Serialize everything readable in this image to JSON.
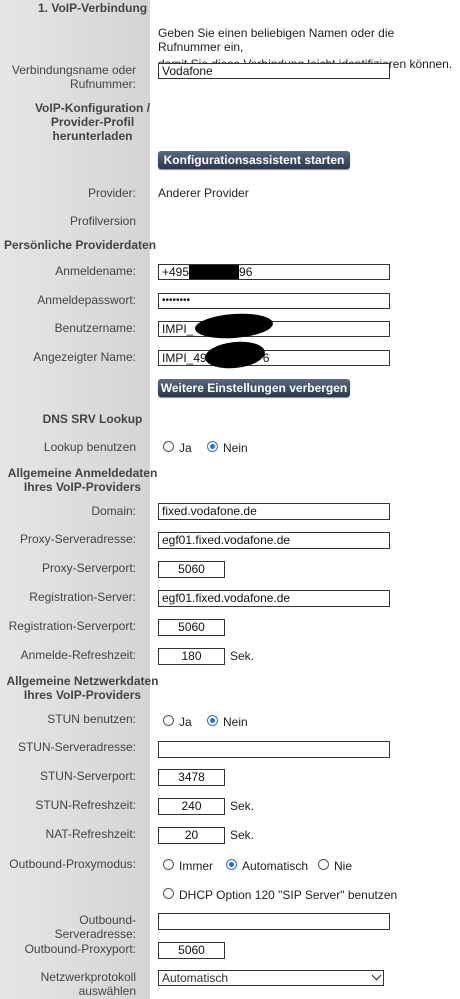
{
  "section1": {
    "title": "1. VoIP-Verbindung"
  },
  "info_text": [
    "Geben Sie einen beliebigen Namen oder die Rufnummer ein,",
    "damit Sie diese Verbindung leicht identifizieren können."
  ],
  "connection_name": {
    "label": [
      "Verbindungsname oder",
      "Rufnummer:"
    ],
    "value": "Vodafone"
  },
  "voip_config": {
    "label": [
      "VoIP-Konfiguration /",
      "Provider-Profil",
      "herunterladen"
    ],
    "button": "Konfigurationsassistent starten"
  },
  "provider": {
    "label": "Provider:",
    "value": "Anderer Provider"
  },
  "profile_version": {
    "label": "Profilversion"
  },
  "personal": {
    "title": "Persönliche Providerdaten"
  },
  "login_name": {
    "label": "Anmeldename:",
    "value_prefix": "+495",
    "value_suffix": "96"
  },
  "login_password": {
    "label": "Anmeldepasswort:",
    "value": "••••••••"
  },
  "username": {
    "label": "Benutzername:",
    "value": "IMPI_"
  },
  "display_name": {
    "label": "Angezeigter Name:",
    "value_prefix": "IMPI_49",
    "value_suffix": "6"
  },
  "more_settings_button": "Weitere Einstellungen verbergen",
  "dns": {
    "title": "DNS SRV Lookup",
    "label": "Lookup benutzen",
    "yes": "Ja",
    "no": "Nein",
    "selected": "Nein"
  },
  "login_data": {
    "title": [
      "Allgemeine Anmeldedaten",
      "Ihres VoIP-Providers"
    ]
  },
  "domain": {
    "label": "Domain:",
    "value": "fixed.vodafone.de"
  },
  "proxy_address": {
    "label": "Proxy-Serveradresse:",
    "value": "egf01.fixed.vodafone.de"
  },
  "proxy_port": {
    "label": "Proxy-Serverport:",
    "value": "5060"
  },
  "registration_server": {
    "label": "Registration-Server:",
    "value": "egf01.fixed.vodafone.de"
  },
  "registration_port": {
    "label": "Registration-Serverport:",
    "value": "5060"
  },
  "refresh_time": {
    "label": "Anmelde-Refreshzeit:",
    "value": "180",
    "unit": "Sek."
  },
  "network_data": {
    "title": [
      "Allgemeine Netzwerkdaten",
      "Ihres VoIP-Providers"
    ]
  },
  "stun_use": {
    "label": "STUN benutzen:",
    "yes": "Ja",
    "no": "Nein",
    "selected": "Nein"
  },
  "stun_address": {
    "label": "STUN-Serveradresse:",
    "value": ""
  },
  "stun_port": {
    "label": "STUN-Serverport:",
    "value": "3478"
  },
  "stun_refresh": {
    "label": "STUN-Refreshzeit:",
    "value": "240",
    "unit": "Sek."
  },
  "nat_refresh": {
    "label": "NAT-Refreshzeit:",
    "value": "20",
    "unit": "Sek."
  },
  "outbound_mode": {
    "label": "Outbound-Proxymodus:",
    "always": "Immer",
    "auto": "Automatisch",
    "never": "Nie",
    "selected": "Automatisch",
    "dhcp": "DHCP Option 120 \"SIP Server\" benutzen"
  },
  "outbound_address": {
    "label": "Outbound-Serveradresse:",
    "value": ""
  },
  "outbound_port": {
    "label": "Outbound-Proxyport:",
    "value": "5060"
  },
  "network_protocol": {
    "label": [
      "Netzwerkprotokoll",
      "auswählen"
    ],
    "value": "Automatisch"
  }
}
